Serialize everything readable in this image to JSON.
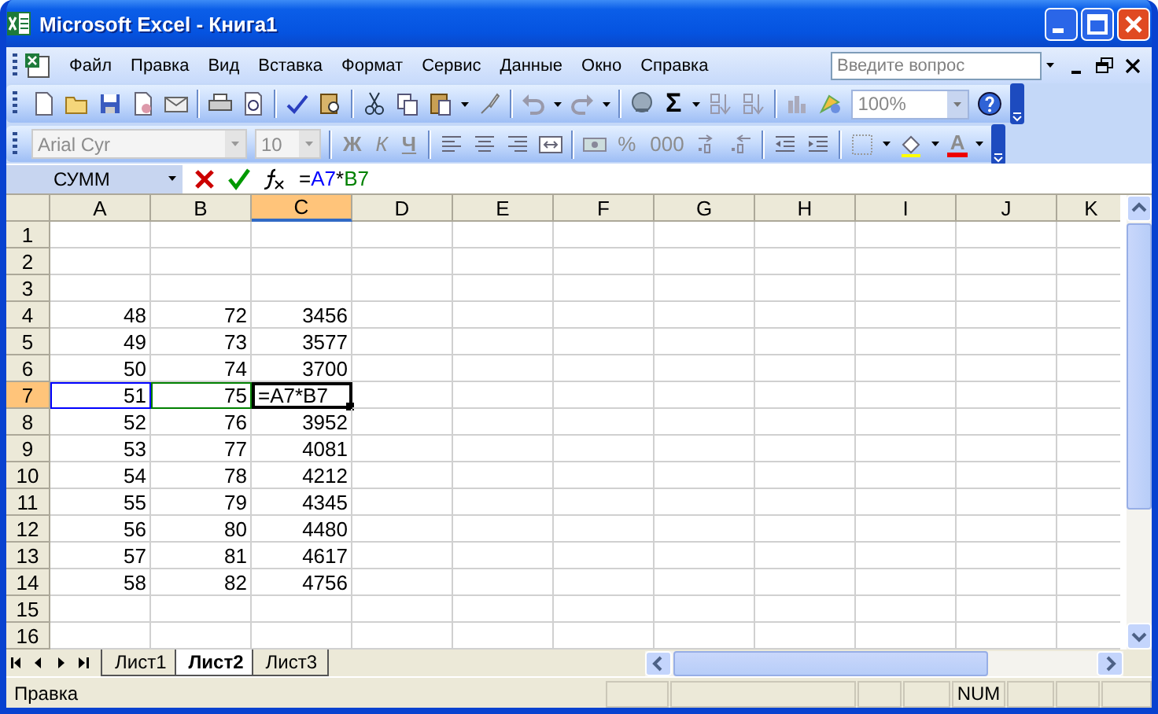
{
  "window": {
    "title": "Microsoft Excel - Книга1"
  },
  "menu": {
    "items": [
      {
        "label": "Файл"
      },
      {
        "label": "Правка"
      },
      {
        "label": "Вид"
      },
      {
        "label": "Вставка"
      },
      {
        "label": "Формат"
      },
      {
        "label": "Сервис"
      },
      {
        "label": "Данные"
      },
      {
        "label": "Окно"
      },
      {
        "label": "Справка"
      }
    ],
    "help_search": {
      "placeholder": "Введите вопрос"
    }
  },
  "standard_toolbar": {
    "sum": "Σ",
    "zoom": "100%"
  },
  "formatting_toolbar": {
    "disabled": true,
    "font": "Arial Cyr",
    "size": "10",
    "bold": "Ж",
    "italic": "К",
    "underline": "Ч",
    "percent": "%",
    "thousands": "000",
    "font_color": "A"
  },
  "formula_bar": {
    "name_box": "СУММ",
    "formula": [
      {
        "text": "="
      },
      {
        "text": "A7",
        "color": "#0000ff"
      },
      {
        "text": "*"
      },
      {
        "text": "B7",
        "color": "#008000"
      }
    ]
  },
  "sheet": {
    "columns": [
      {
        "label": "A",
        "selected": false
      },
      {
        "label": "B",
        "selected": false
      },
      {
        "label": "C",
        "selected": true
      },
      {
        "label": "D",
        "selected": false
      },
      {
        "label": "E",
        "selected": false
      },
      {
        "label": "F",
        "selected": false
      },
      {
        "label": "G",
        "selected": false
      },
      {
        "label": "H",
        "selected": false
      },
      {
        "label": "I",
        "selected": false
      },
      {
        "label": "J",
        "selected": false
      },
      {
        "label": "K",
        "selected": false
      }
    ],
    "rows": [
      {
        "label": "1",
        "selected": false,
        "cells": []
      },
      {
        "label": "2",
        "selected": false,
        "cells": []
      },
      {
        "label": "3",
        "selected": false,
        "cells": []
      },
      {
        "label": "4",
        "selected": false,
        "cells": [
          {
            "value": "48"
          },
          {
            "value": "72"
          },
          {
            "value": "3456"
          }
        ]
      },
      {
        "label": "5",
        "selected": false,
        "cells": [
          {
            "value": "49"
          },
          {
            "value": "73"
          },
          {
            "value": "3577"
          }
        ]
      },
      {
        "label": "6",
        "selected": false,
        "cells": [
          {
            "value": "50"
          },
          {
            "value": "74"
          },
          {
            "value": "3700"
          }
        ]
      },
      {
        "label": "7",
        "selected": true,
        "cells": [
          {
            "value": "51",
            "color": "#0000ff"
          },
          {
            "value": "75",
            "color": "#008000"
          },
          {
            "value": "=A7*B7",
            "editing": true
          }
        ]
      },
      {
        "label": "8",
        "selected": false,
        "cells": [
          {
            "value": "52"
          },
          {
            "value": "76"
          },
          {
            "value": "3952"
          }
        ]
      },
      {
        "label": "9",
        "selected": false,
        "cells": [
          {
            "value": "53"
          },
          {
            "value": "77"
          },
          {
            "value": "4081"
          }
        ]
      },
      {
        "label": "10",
        "selected": false,
        "cells": [
          {
            "value": "54"
          },
          {
            "value": "78"
          },
          {
            "value": "4212"
          }
        ]
      },
      {
        "label": "11",
        "selected": false,
        "cells": [
          {
            "value": "55"
          },
          {
            "value": "79"
          },
          {
            "value": "4345"
          }
        ]
      },
      {
        "label": "12",
        "selected": false,
        "cells": [
          {
            "value": "56"
          },
          {
            "value": "80"
          },
          {
            "value": "4480"
          }
        ]
      },
      {
        "label": "13",
        "selected": false,
        "cells": [
          {
            "value": "57"
          },
          {
            "value": "81"
          },
          {
            "value": "4617"
          }
        ]
      },
      {
        "label": "14",
        "selected": false,
        "cells": [
          {
            "value": "58"
          },
          {
            "value": "82"
          },
          {
            "value": "4756"
          }
        ]
      },
      {
        "label": "15",
        "selected": false,
        "cells": []
      },
      {
        "label": "16",
        "selected": false,
        "cells": []
      }
    ]
  },
  "sheet_tabs": [
    {
      "label": "Лист1",
      "selected": false
    },
    {
      "label": "Лист2",
      "selected": true
    },
    {
      "label": "Лист3",
      "selected": false
    }
  ],
  "status_bar": {
    "mode": "Правка",
    "indicators": [
      "NUM"
    ]
  }
}
